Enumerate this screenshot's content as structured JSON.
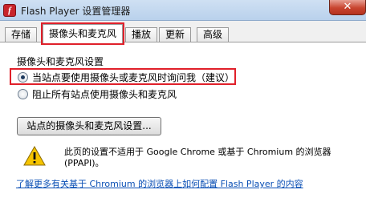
{
  "window": {
    "title": "Flash Player 设置管理器",
    "close_label": "✕"
  },
  "tabs": [
    {
      "label": "存储"
    },
    {
      "label": "摄像头和麦克风"
    },
    {
      "label": "播放"
    },
    {
      "label": "更新"
    },
    {
      "label": "高级"
    }
  ],
  "camera_mic": {
    "group_label": "摄像头和麦克风设置",
    "options": [
      {
        "label": "当站点要使用摄像头或麦克风时询问我（建议）",
        "selected": true
      },
      {
        "label": "阻止所有站点使用摄像头和麦克风",
        "selected": false
      }
    ],
    "site_settings_button": "站点的摄像头和麦克风设置..."
  },
  "notice": {
    "line1": "此页的设置不适用于 Google Chrome 或基于 Chromium 的浏览器",
    "line2": "(PPAPI)。",
    "link": "了解更多有关基于 Chromium 的浏览器上如何配置 Flash Player 的内容"
  },
  "colors": {
    "annotation_red": "#e0202a",
    "link_blue": "#0a4fb5"
  },
  "icons": {
    "app": "flash-player-icon",
    "warning": "warning-icon"
  }
}
